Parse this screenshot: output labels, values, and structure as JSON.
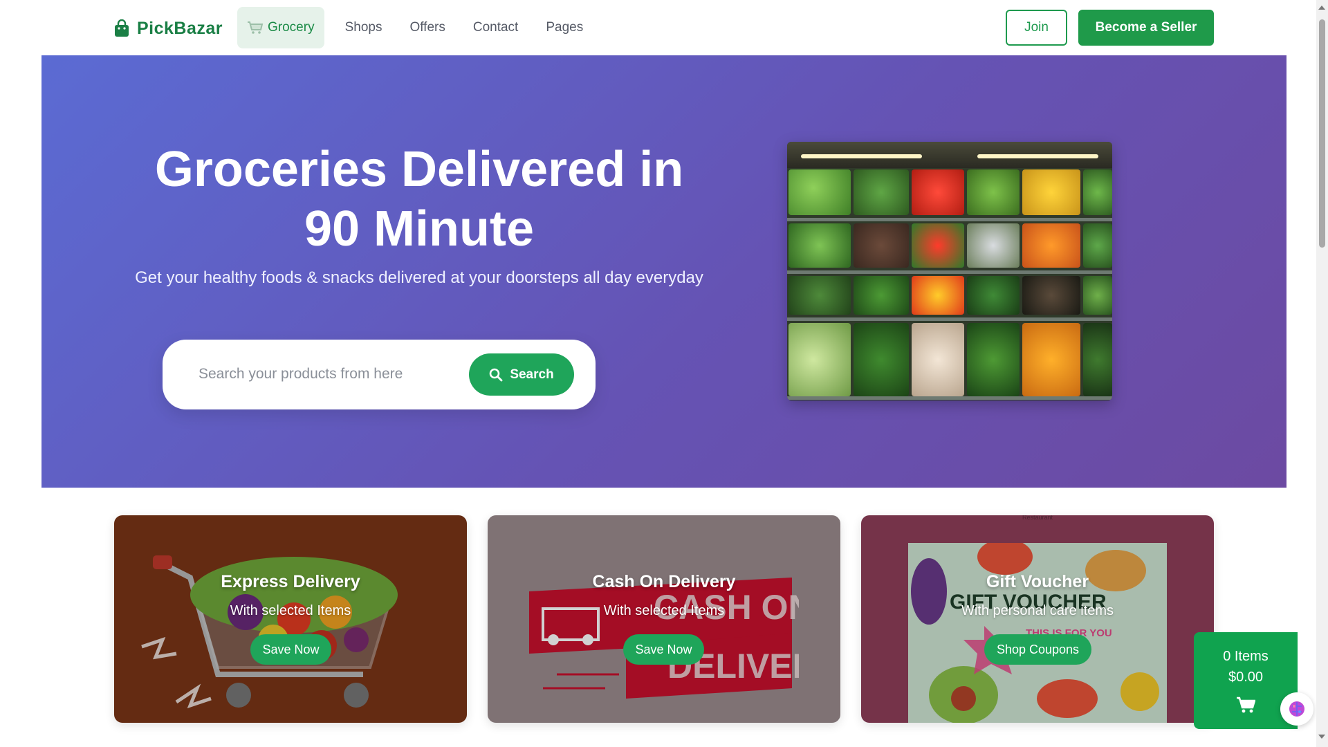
{
  "brand": {
    "name": "PickBazar",
    "color": "#1a7f45"
  },
  "nav": {
    "items": [
      {
        "label": "Grocery",
        "active": true,
        "icon": "cart-icon"
      },
      {
        "label": "Shops"
      },
      {
        "label": "Offers"
      },
      {
        "label": "Contact"
      },
      {
        "label": "Pages"
      }
    ]
  },
  "header_actions": {
    "join_label": "Join",
    "seller_label": "Become a Seller"
  },
  "hero": {
    "title_line1": "Groceries Delivered in",
    "title_line2": "90 Minute",
    "subtitle": "Get your healthy foods & snacks delivered at your doorsteps all day everyday",
    "search": {
      "placeholder": "Search your products from here",
      "button_label": "Search"
    }
  },
  "promos": [
    {
      "title": "Express Delivery",
      "subtitle": "With selected Items",
      "button": "Save Now",
      "bg": "#7a3516"
    },
    {
      "title": "Cash On Delivery",
      "subtitle": "With selected Items",
      "button": "Save Now",
      "bg": "#9c8c8e"
    },
    {
      "title": "Gift Voucher",
      "subtitle": "With personal care items",
      "button": "Shop Coupons",
      "bg": "#8f3f5a",
      "top_note": "Restaurant"
    }
  ],
  "cart": {
    "items_label": "0 Items",
    "total": "$0.00"
  },
  "colors": {
    "accent": "#1fa55a",
    "hero_start": "#5b6bd3",
    "hero_end": "#6c4aa2"
  }
}
